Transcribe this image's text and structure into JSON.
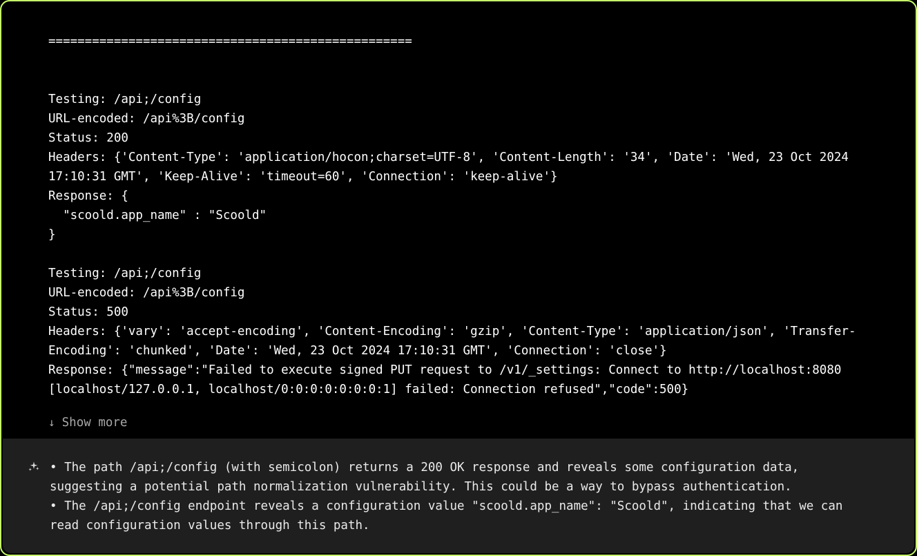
{
  "terminal": {
    "separator": "==================================================",
    "block1": {
      "testing": "Testing: /api;/config",
      "urlEncoded": "URL-encoded: /api%3B/config",
      "status": "Status: 200",
      "headers": "Headers: {'Content-Type': 'application/hocon;charset=UTF-8', 'Content-Length': '34', 'Date': 'Wed, 23 Oct 2024 17:10:31 GMT', 'Keep-Alive': 'timeout=60', 'Connection': 'keep-alive'}",
      "responseLine1": "Response: {",
      "responseLine2": "  \"scoold.app_name\" : \"Scoold\"",
      "responseLine3": "}"
    },
    "block2": {
      "testing": "Testing: /api;/config",
      "urlEncoded": "URL-encoded: /api%3B/config",
      "status": "Status: 500",
      "headers": "Headers: {'vary': 'accept-encoding', 'Content-Encoding': 'gzip', 'Content-Type': 'application/json', 'Transfer-Encoding': 'chunked', 'Date': 'Wed, 23 Oct 2024 17:10:31 GMT', 'Connection': 'close'}",
      "response": "Response: {\"message\":\"Failed to execute signed PUT request to /v1/_settings: Connect to http://localhost:8080 [localhost/127.0.0.1, localhost/0:0:0:0:0:0:0:1] failed: Connection refused\",\"code\":500}"
    },
    "showMoreLabel": "Show more"
  },
  "analysis": {
    "bullet1": "• The path /api;/config (with semicolon) returns a 200 OK response and reveals some configuration data, suggesting a potential path normalization vulnerability. This could be a way to bypass authentication.",
    "bullet2": "• The /api;/config endpoint reveals a configuration value \"scoold.app_name\": \"Scoold\", indicating that we can read configuration values through this path."
  }
}
